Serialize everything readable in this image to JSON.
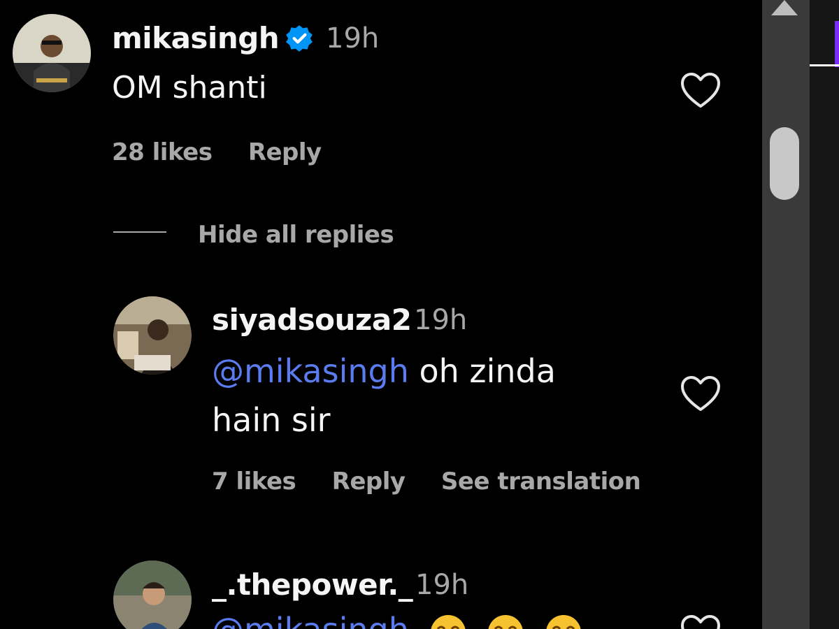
{
  "comment": {
    "username": "mikasingh",
    "time": "19h",
    "text": "OM shanti",
    "likes": "28 likes",
    "reply": "Reply"
  },
  "hide_replies": "Hide all replies",
  "replies": [
    {
      "username": "siyadsouza2",
      "time": "19h",
      "mention": "@mikasingh",
      "text_line1": " oh zinda",
      "text_line2": "hain sir",
      "likes": "7 likes",
      "reply": "Reply",
      "translate": "See translation"
    },
    {
      "username": "_.thepower._",
      "time": "19h",
      "mention": "@mikasingh",
      "emojis": [
        "laughing-emoji",
        "laughing-emoji",
        "laughing-emoji"
      ]
    }
  ],
  "colors": {
    "background": "#000000",
    "text": "#f5f5f5",
    "secondary": "#a8a8a8",
    "mention": "#5b7cf0",
    "verified": "#0095f6"
  }
}
